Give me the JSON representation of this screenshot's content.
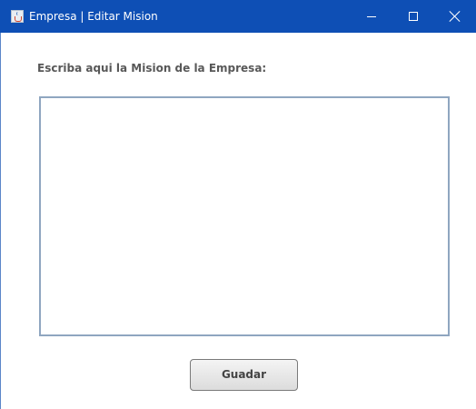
{
  "window": {
    "title": "Empresa | Editar Mision",
    "accent_color": "#0e4fb5",
    "app_icon": "java-icon",
    "controls": {
      "minimize_icon": "minimize-icon",
      "maximize_icon": "maximize-icon",
      "close_icon": "close-icon"
    }
  },
  "form": {
    "prompt_label": "Escriba aqui la Mision de la Empresa:",
    "mission_text": "",
    "save_label": "Guadar"
  }
}
